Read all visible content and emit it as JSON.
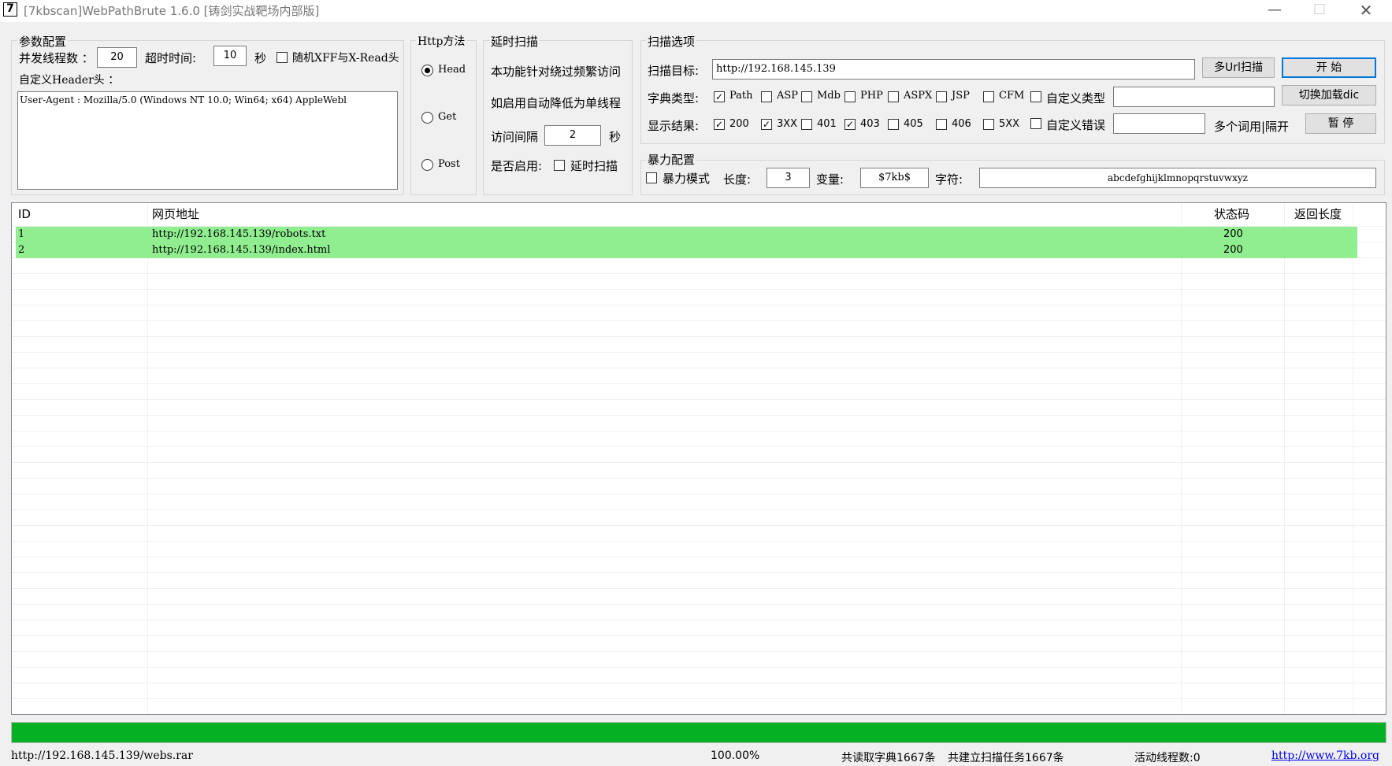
{
  "window": {
    "icon_glyph": "7",
    "title": "[7kbscan]WebPathBrute 1.6.0 [铸剑实战靶场内部版]",
    "minimize_glyph": "—",
    "maximize_glyph": "☐",
    "close_glyph": "✕"
  },
  "params": {
    "group_label": "参数配置",
    "threads_label": "并发线程数 ：",
    "threads_value": "20",
    "timeout_label": "超时时间:",
    "timeout_value": "10",
    "timeout_unit": "秒",
    "random_xff_label": "随机XFF与X-Read头",
    "random_xff_checked": false,
    "header_label": "自定义Header头 ：",
    "header_value": "User-Agent : Mozilla/5.0 (Windows NT 10.0; Win64; x64) AppleWebl"
  },
  "http_method": {
    "group_label": "Http方法",
    "options": [
      {
        "label": "Head",
        "selected": true
      },
      {
        "label": "Get",
        "selected": false
      },
      {
        "label": "Post",
        "selected": false
      }
    ]
  },
  "delay": {
    "group_label": "延时扫描",
    "desc_line1": "本功能针对绕过频繁访问",
    "desc_line2": "如启用自动降低为单线程",
    "interval_label": "访问间隔",
    "interval_value": "2",
    "interval_unit": "秒",
    "enable_label": "是否启用:",
    "enable_checkbox_label": "延时扫描",
    "enable_checked": false
  },
  "scan_options": {
    "group_label": "扫描选项",
    "target_label": "扫描目标:",
    "target_value": "http://192.168.145.139",
    "multi_url_button": "多Url扫描",
    "start_button": "开 始",
    "dict_type_label": "字典类型:",
    "dict_types": [
      {
        "label": "Path",
        "checked": true
      },
      {
        "label": "ASP",
        "checked": false
      },
      {
        "label": "Mdb",
        "checked": false
      },
      {
        "label": "PHP",
        "checked": false
      },
      {
        "label": "ASPX",
        "checked": false
      },
      {
        "label": "JSP",
        "checked": false
      },
      {
        "label": "CFM",
        "checked": false
      }
    ],
    "custom_type_label": "自定义类型",
    "custom_type_checked": false,
    "custom_type_value": "",
    "switch_dict_button": "切换加载dic",
    "show_results_label": "显示结果:",
    "show_results": [
      {
        "label": "200",
        "checked": true
      },
      {
        "label": "3XX",
        "checked": true
      },
      {
        "label": "401",
        "checked": false
      },
      {
        "label": "403",
        "checked": true
      },
      {
        "label": "405",
        "checked": false
      },
      {
        "label": "406",
        "checked": false
      },
      {
        "label": "5XX",
        "checked": false
      }
    ],
    "custom_error_label": "自定义错误",
    "custom_error_checked": false,
    "custom_error_value": "",
    "multi_word_hint": "多个词用|隔开",
    "pause_button": "暂 停"
  },
  "brute": {
    "group_label": "暴力配置",
    "mode_label": "暴力模式",
    "mode_checked": false,
    "length_label": "长度:",
    "length_value": "3",
    "variable_label": "变量:",
    "variable_value": "$7kb$",
    "chars_label": "字符:",
    "chars_value": "abcdefghijklmnopqrstuvwxyz"
  },
  "results": {
    "columns": [
      "ID",
      "网页地址",
      "状态码",
      "返回长度"
    ],
    "rows": [
      {
        "id": "1",
        "url": "http://192.168.145.139/robots.txt",
        "status": "200",
        "length": ""
      },
      {
        "id": "2",
        "url": "http://192.168.145.139/index.html",
        "status": "200",
        "length": ""
      }
    ],
    "row_highlight_color": "#90ee90"
  },
  "progress": {
    "fraction": 1.0,
    "color": "#06b025"
  },
  "statusbar": {
    "current_url": "http://192.168.145.139/webs.rar",
    "percent": "100.00%",
    "dict_read": "共读取字典1667条",
    "tasks_created": "共建立扫描任务1667条",
    "active_threads": "活动线程数:0",
    "website_link": "http://www.7kb.org"
  }
}
